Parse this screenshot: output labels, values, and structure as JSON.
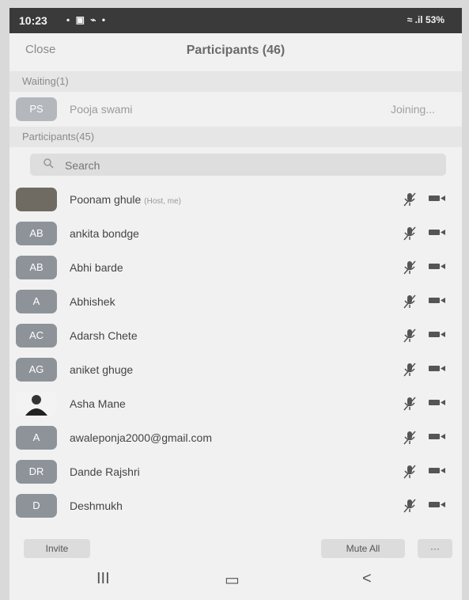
{
  "status": {
    "time": "10:23",
    "right": "≈ .il 53%"
  },
  "header": {
    "close": "Close",
    "title": "Participants (46)"
  },
  "waiting": {
    "section_label": "Waiting(1)",
    "person": {
      "initials": "PS",
      "name": "Pooja swami",
      "status": "Joining..."
    }
  },
  "participants": {
    "section_label": "Participants(45)",
    "search_placeholder": "Search",
    "items": [
      {
        "initials": "",
        "name": "Poonam ghule",
        "tag": "(Host, me)",
        "avatar": "photo"
      },
      {
        "initials": "AB",
        "name": "ankita bondge",
        "tag": "",
        "avatar": "initials"
      },
      {
        "initials": "AB",
        "name": "Abhi barde",
        "tag": "",
        "avatar": "initials"
      },
      {
        "initials": "A",
        "name": "Abhishek",
        "tag": "",
        "avatar": "initials"
      },
      {
        "initials": "AC",
        "name": "Adarsh Chete",
        "tag": "",
        "avatar": "initials"
      },
      {
        "initials": "AG",
        "name": "aniket ghuge",
        "tag": "",
        "avatar": "initials"
      },
      {
        "initials": "",
        "name": "Asha Mane",
        "tag": "",
        "avatar": "photo2"
      },
      {
        "initials": "A",
        "name": "awaleponja2000@gmail.com",
        "tag": "",
        "avatar": "initials"
      },
      {
        "initials": "DR",
        "name": "Dande Rajshri",
        "tag": "",
        "avatar": "initials"
      },
      {
        "initials": "D",
        "name": "Deshmukh",
        "tag": "",
        "avatar": "initials"
      }
    ]
  },
  "bottom": {
    "invite": "Invite",
    "mute_all": "Mute All",
    "more": "···"
  },
  "nav": {
    "recents": "III",
    "home": "▭",
    "back": "<"
  }
}
